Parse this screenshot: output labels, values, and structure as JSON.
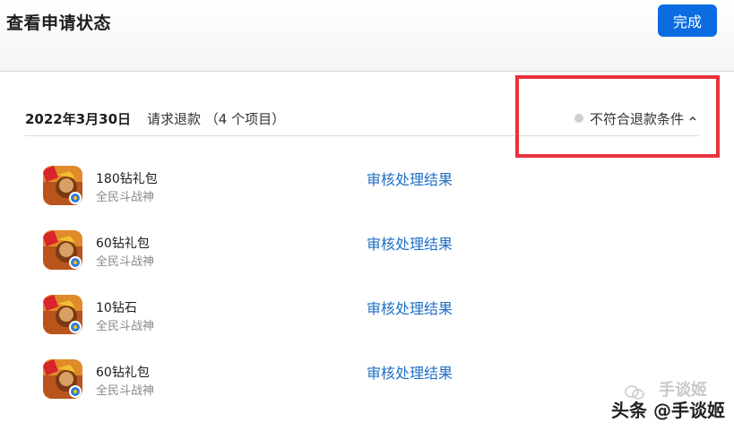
{
  "header": {
    "title": "查看申请状态",
    "done_label": "完成",
    "accent": "#0a6ce0"
  },
  "request": {
    "date": "2022年3月30日",
    "description": "请求退款 （4 个项目）",
    "status": "不符合退款条件",
    "status_icon": "chevron-up-icon",
    "highlight_color": "#e8323c"
  },
  "items": [
    {
      "name": "180钻礼包",
      "app": "全民斗战神",
      "link": "审核处理结果"
    },
    {
      "name": "60钻礼包",
      "app": "全民斗战神",
      "link": "审核处理结果"
    },
    {
      "name": "10钻石",
      "app": "全民斗战神",
      "link": "审核处理结果"
    },
    {
      "name": "60钻礼包",
      "app": "全民斗战神",
      "link": "审核处理结果"
    }
  ],
  "watermark": {
    "text": "头条 @手谈姬",
    "faint_text": "手谈姬",
    "icon": "wechat-icon"
  }
}
